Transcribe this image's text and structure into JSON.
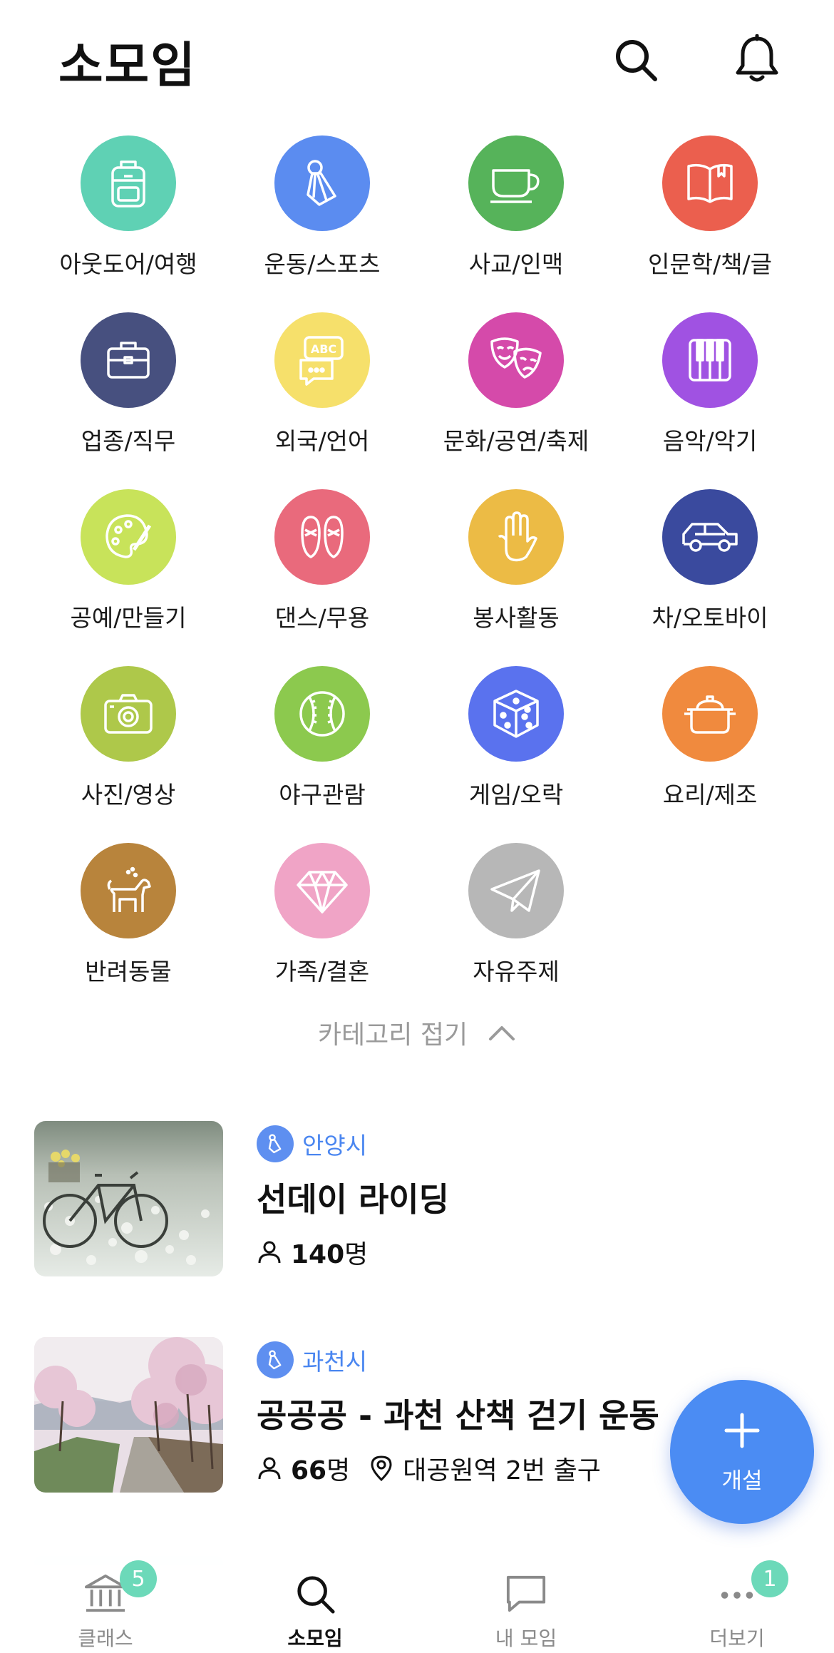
{
  "app": {
    "title": "소모임"
  },
  "header": {
    "search_icon": "search-icon",
    "bell_icon": "bell-icon"
  },
  "categories": [
    {
      "label": "아웃도어/여행",
      "color": "#5fd1b4",
      "icon": "backpack-icon"
    },
    {
      "label": "운동/스포츠",
      "color": "#5b8cf0",
      "icon": "shuttlecock-icon"
    },
    {
      "label": "사교/인맥",
      "color": "#56b35a",
      "icon": "coffee-cup-icon"
    },
    {
      "label": "인문학/책/글",
      "color": "#eb5f4e",
      "icon": "book-icon"
    },
    {
      "label": "업종/직무",
      "color": "#47507f",
      "icon": "briefcase-icon"
    },
    {
      "label": "외국/언어",
      "color": "#f6e06b",
      "icon": "speech-abc-icon"
    },
    {
      "label": "문화/공연/축제",
      "color": "#d54aaa",
      "icon": "theater-masks-icon"
    },
    {
      "label": "음악/악기",
      "color": "#a052e2",
      "icon": "piano-icon"
    },
    {
      "label": "공예/만들기",
      "color": "#c8e35a",
      "icon": "palette-icon"
    },
    {
      "label": "댄스/무용",
      "color": "#e96a7c",
      "icon": "ballet-shoes-icon"
    },
    {
      "label": "봉사활동",
      "color": "#ecbb45",
      "icon": "hand-icon"
    },
    {
      "label": "차/오토바이",
      "color": "#3a4a9e",
      "icon": "car-icon"
    },
    {
      "label": "사진/영상",
      "color": "#aec84a",
      "icon": "camera-icon"
    },
    {
      "label": "야구관람",
      "color": "#8cc94e",
      "icon": "baseball-icon"
    },
    {
      "label": "게임/오락",
      "color": "#5a72ee",
      "icon": "dice-icon"
    },
    {
      "label": "요리/제조",
      "color": "#f08a3e",
      "icon": "pot-icon"
    },
    {
      "label": "반려동물",
      "color": "#b8843c",
      "icon": "dog-icon"
    },
    {
      "label": "가족/결혼",
      "color": "#f0a4c6",
      "icon": "diamond-icon"
    },
    {
      "label": "자유주제",
      "color": "#b7b7b7",
      "icon": "paper-plane-icon"
    }
  ],
  "collapse": {
    "label": "카테고리 접기",
    "icon": "chevron-up-icon"
  },
  "groups": [
    {
      "region": "안양시",
      "title": "선데이 라이딩",
      "members": "140",
      "members_unit": "명",
      "place": ""
    },
    {
      "region": "과천시",
      "title": "공공공 - 과천 산책 걷기 운동",
      "members": "66",
      "members_unit": "명",
      "place": "대공원역 2번 출구"
    }
  ],
  "fab": {
    "label": "개설"
  },
  "tabs": [
    {
      "label": "클래스",
      "icon": "bank-icon",
      "badge": "5"
    },
    {
      "label": "소모임",
      "icon": "search-icon",
      "badge": ""
    },
    {
      "label": "내 모임",
      "icon": "chat-bubble-icon",
      "badge": ""
    },
    {
      "label": "더보기",
      "icon": "more-dots-icon",
      "badge": "1"
    }
  ],
  "active_tab": "소모임"
}
